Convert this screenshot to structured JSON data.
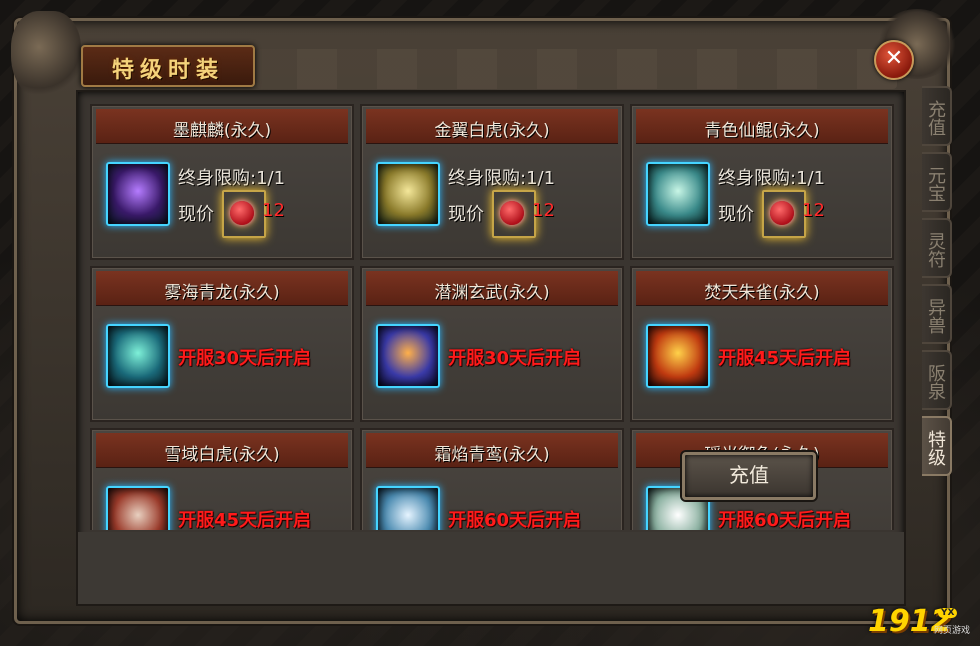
{
  "window": {
    "title": "特级时装",
    "close_symbol": "✕",
    "recharge_label": "充值"
  },
  "tabs": [
    {
      "label": "充值",
      "active": false
    },
    {
      "label": "元宝",
      "active": false
    },
    {
      "label": "灵符",
      "active": false
    },
    {
      "label": "异兽",
      "active": false
    },
    {
      "label": "阪泉",
      "active": false
    },
    {
      "label": "特级",
      "active": true
    }
  ],
  "items": [
    {
      "name": "墨麒麟(永久)",
      "limit": "终身限购:1/1",
      "price_label": "现价",
      "price": "12",
      "icon": "purple-qilin-icon"
    },
    {
      "name": "金翼白虎(永久)",
      "limit": "终身限购:1/1",
      "price_label": "现价",
      "price": "12",
      "icon": "golden-tiger-icon"
    },
    {
      "name": "青色仙鲲(永久)",
      "limit": "终身限购:1/1",
      "price_label": "现价",
      "price": "12",
      "icon": "cyan-kun-icon"
    },
    {
      "name": "雾海青龙(永久)",
      "open_text": "开服30天后开启",
      "icon": "azure-dragon-icon"
    },
    {
      "name": "潜渊玄武(永久)",
      "open_text": "开服30天后开启",
      "icon": "black-tortoise-icon"
    },
    {
      "name": "焚天朱雀(永久)",
      "open_text": "开服45天后开启",
      "icon": "vermilion-bird-icon"
    },
    {
      "name": "雪域白虎(永久)",
      "open_text": "开服45天后开启",
      "icon": "snow-tiger-icon"
    },
    {
      "name": "霜焰青鸾(永久)",
      "open_text": "开服60天后开启",
      "icon": "frost-phoenix-icon"
    },
    {
      "name": "瑶光御兔(永久)",
      "open_text": "开服60天后开启",
      "icon": "jade-rabbit-icon"
    }
  ],
  "logo": {
    "number": "1912",
    "badge": "YX",
    "sub": "网页游戏"
  },
  "colors": {
    "title": "#f4d27a",
    "open_text": "#ff1a1a",
    "price": "#ff2a2a",
    "card_head": "#7a3320",
    "icon_border": "#45d4ff"
  }
}
